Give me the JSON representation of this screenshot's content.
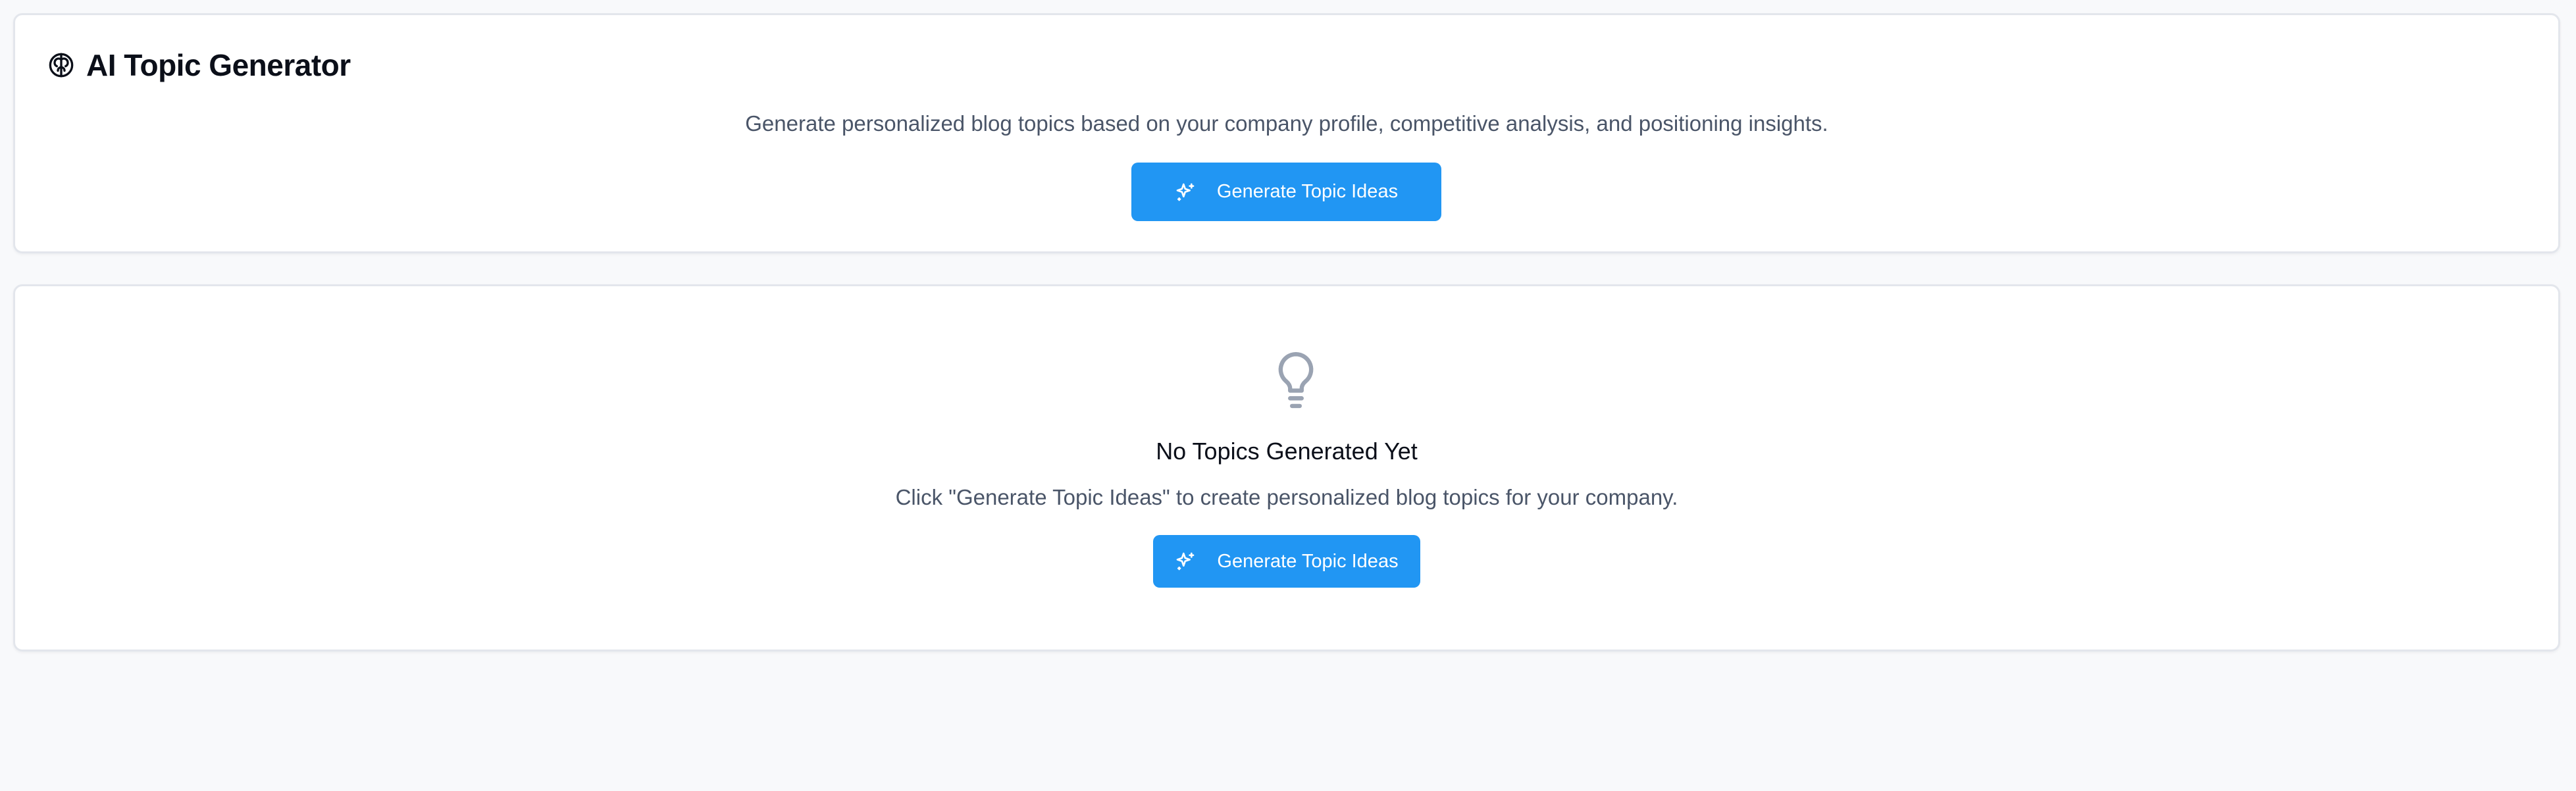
{
  "generator": {
    "title": "AI Topic Generator",
    "title_icon": "brain-icon",
    "description": "Generate personalized blog topics based on your company profile, competitive analysis, and positioning insights.",
    "button_label": "Generate Topic Ideas",
    "button_icon": "sparkles-icon"
  },
  "empty_state": {
    "icon": "lightbulb-icon",
    "title": "No Topics Generated Yet",
    "text": "Click \"Generate Topic Ideas\" to create personalized blog topics for your company.",
    "button_label": "Generate Topic Ideas",
    "button_icon": "sparkles-icon"
  },
  "colors": {
    "accent": "#2196f3",
    "background": "#f8f9fb",
    "card": "#ffffff",
    "muted_text": "#4a5568",
    "icon_gray": "#9aa3b2"
  }
}
